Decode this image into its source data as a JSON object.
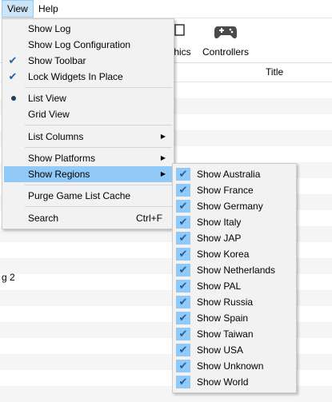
{
  "menubar": {
    "view": "View",
    "help": "Help"
  },
  "toolbar": {
    "graphics_label": "hics",
    "controllers_label": "Controllers"
  },
  "list": {
    "title_header": "Title",
    "partial_row_text": "g 2",
    "partial_row_text_top": "0"
  },
  "view_menu": {
    "items": [
      {
        "label": "Show Log",
        "checked": false
      },
      {
        "label": "Show Log Configuration",
        "checked": false
      },
      {
        "label": "Show Toolbar",
        "checked": true
      },
      {
        "label": "Lock Widgets In Place",
        "checked": true
      },
      {
        "label": "List View",
        "radio": true
      },
      {
        "label": "Grid View"
      },
      {
        "label": "List Columns"
      },
      {
        "label": "Show Platforms"
      },
      {
        "label": "Show Regions"
      },
      {
        "label": "Purge Game List Cache"
      },
      {
        "label": "Search",
        "shortcut": "Ctrl+F"
      }
    ]
  },
  "regions_menu": {
    "items": [
      "Show Australia",
      "Show France",
      "Show Germany",
      "Show Italy",
      "Show JAP",
      "Show Korea",
      "Show Netherlands",
      "Show PAL",
      "Show Russia",
      "Show Spain",
      "Show Taiwan",
      "Show USA",
      "Show Unknown",
      "Show World"
    ]
  },
  "colors": {
    "highlight": "#91c9f7",
    "check": "#1f5fa5",
    "menu_bg": "#f2f2f2"
  }
}
